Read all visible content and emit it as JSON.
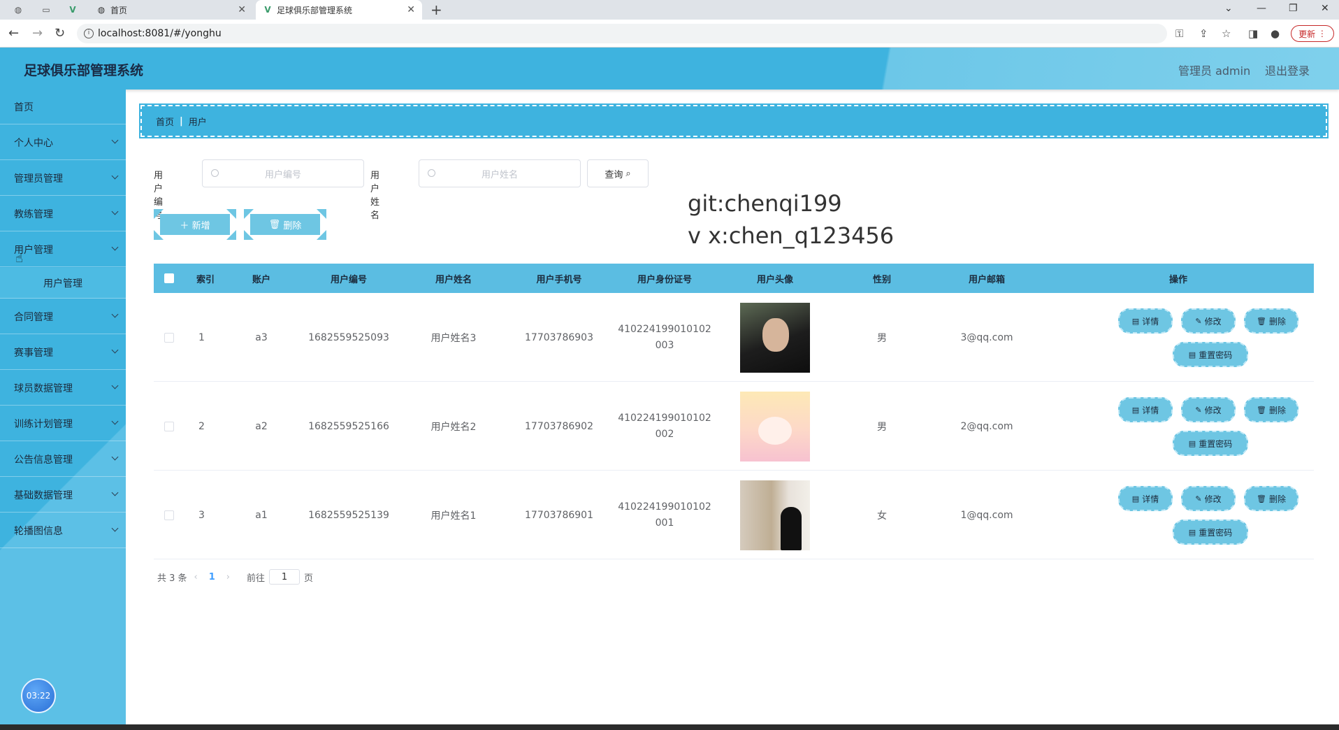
{
  "browser": {
    "tabs": [
      {
        "title": "首页",
        "active": false
      },
      {
        "title": "足球俱乐部管理系统",
        "active": true
      }
    ],
    "url": "localhost:8081/#/yonghu",
    "update_label": "更新"
  },
  "header": {
    "title": "足球俱乐部管理系统",
    "user": "管理员 admin",
    "logout": "退出登录"
  },
  "sidebar": {
    "items": [
      {
        "label": "首页"
      },
      {
        "label": "个人中心"
      },
      {
        "label": "管理员管理"
      },
      {
        "label": "教练管理"
      },
      {
        "label": "用户管理"
      },
      {
        "label": "合同管理"
      },
      {
        "label": "赛事管理"
      },
      {
        "label": "球员数据管理"
      },
      {
        "label": "训练计划管理"
      },
      {
        "label": "公告信息管理"
      },
      {
        "label": "基础数据管理"
      },
      {
        "label": "轮播图信息"
      }
    ],
    "submenu": {
      "label": "用户管理"
    },
    "clock": "03:22"
  },
  "breadcrumb": {
    "home": "首页",
    "current": "用户"
  },
  "search": {
    "field1_label": "用户编号",
    "field1_placeholder": "用户编号",
    "field2_label": "用户姓名",
    "field2_placeholder": "用户姓名",
    "query_label": "查询"
  },
  "actions": {
    "add_label": "新增",
    "delete_label": "删除"
  },
  "watermark": {
    "line1": "git:chenqi199",
    "line2": "v x:chen_q123456"
  },
  "table": {
    "headers": [
      "索引",
      "账户",
      "用户编号",
      "用户姓名",
      "用户手机号",
      "用户身份证号",
      "用户头像",
      "性别",
      "用户邮箱",
      "操作"
    ],
    "rows": [
      {
        "index": "1",
        "account": "a3",
        "number": "1682559525093",
        "name": "用户姓名3",
        "phone": "17703786903",
        "id_line1": "410224199010102",
        "id_line2": "003",
        "gender": "男",
        "email": "3@qq.com"
      },
      {
        "index": "2",
        "account": "a2",
        "number": "1682559525166",
        "name": "用户姓名2",
        "phone": "17703786902",
        "id_line1": "410224199010102",
        "id_line2": "002",
        "gender": "男",
        "email": "2@qq.com"
      },
      {
        "index": "3",
        "account": "a1",
        "number": "1682559525139",
        "name": "用户姓名1",
        "phone": "17703786901",
        "id_line1": "410224199010102",
        "id_line2": "001",
        "gender": "女",
        "email": "1@qq.com"
      }
    ],
    "ops": {
      "detail": "详情",
      "edit": "修改",
      "delete": "删除",
      "reset": "重置密码"
    }
  },
  "pager": {
    "total": "共 3 条",
    "current": "1",
    "goto_label": "前往",
    "goto_value": "1",
    "page_suffix": "页"
  }
}
